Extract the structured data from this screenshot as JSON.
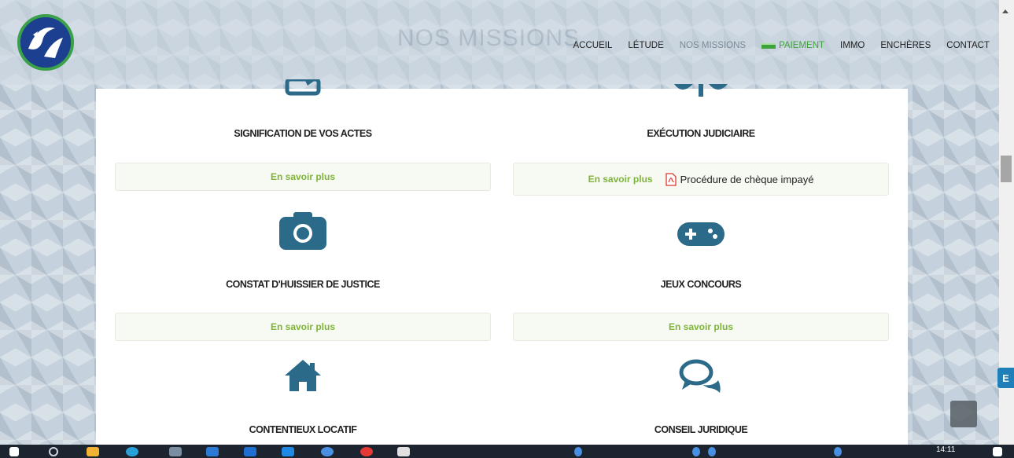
{
  "header": {
    "ghost_title": "NOS MISSIONS",
    "nav": [
      {
        "label": "ACCUEIL"
      },
      {
        "label": "LÉTUDE"
      },
      {
        "label": "NOS MISSIONS"
      },
      {
        "label": "PAIEMENT"
      },
      {
        "label": "IMMO"
      },
      {
        "label": "ENCHÈRES"
      },
      {
        "label": "CONTACT"
      }
    ]
  },
  "missions": [
    {
      "title": "SIGNIFICATION DE VOS ACTES",
      "icon": "edit-icon",
      "more": "En savoir plus"
    },
    {
      "title": "EXÉCUTION JUDICIAIRE",
      "icon": "balance-scale-icon",
      "more": "En savoir plus",
      "pdf_link": "Procédure de chèque impayé"
    },
    {
      "title": "CONSTAT D'HUISSIER DE JUSTICE",
      "icon": "camera-icon",
      "more": "En savoir plus"
    },
    {
      "title": "JEUX CONCOURS",
      "icon": "gamepad-icon",
      "more": "En savoir plus"
    },
    {
      "title": "CONTENTIEUX LOCATIF",
      "icon": "home-icon"
    },
    {
      "title": "CONSEIL JURIDIQUE",
      "icon": "comments-icon"
    }
  ],
  "side_tab": "E",
  "taskbar": {
    "clock": "14:11"
  },
  "colors": {
    "accent_green": "#7fb43a",
    "icon_blue": "#2c6a8a",
    "logo_blue": "#1d3f8f"
  }
}
